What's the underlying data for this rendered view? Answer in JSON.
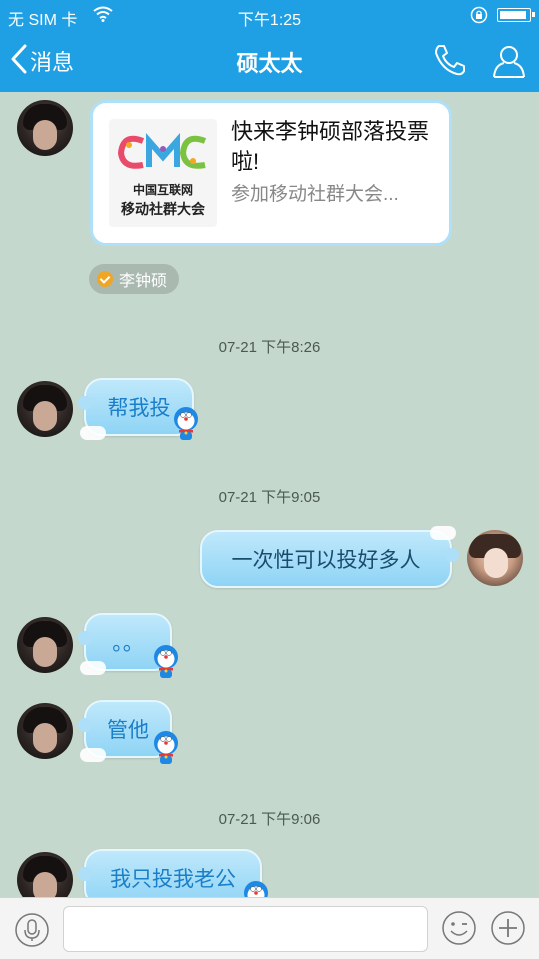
{
  "status_bar": {
    "carrier": "无 SIM 卡",
    "time": "下午1:25"
  },
  "nav": {
    "back_label": "消息",
    "title": "硕太太"
  },
  "shared_card": {
    "title": "快来李钟硕部落投票啦!",
    "description": "参加移动社群大会...",
    "logo_line1": "中国互联网",
    "logo_line2": "移动社群大会",
    "sender_tag": "李钟硕"
  },
  "messages": [
    {
      "timestamp": "07-21 下午8:26",
      "text": "帮我投",
      "direction": "incoming"
    },
    {
      "timestamp": "07-21 下午9:05",
      "text": "一次性可以投好多人",
      "direction": "outgoing"
    },
    {
      "timestamp": "",
      "text": "。。",
      "direction": "incoming"
    },
    {
      "timestamp": "",
      "text": "管他",
      "direction": "incoming"
    },
    {
      "timestamp": "07-21 下午9:06",
      "text": "我只投我老公",
      "direction": "incoming"
    }
  ],
  "input": {
    "placeholder": ""
  },
  "colors": {
    "header": "#1fa0e4",
    "chat_background": "#c5d8cd",
    "bubble": "#aedff8",
    "bubble_text": "#1a7fc8"
  }
}
